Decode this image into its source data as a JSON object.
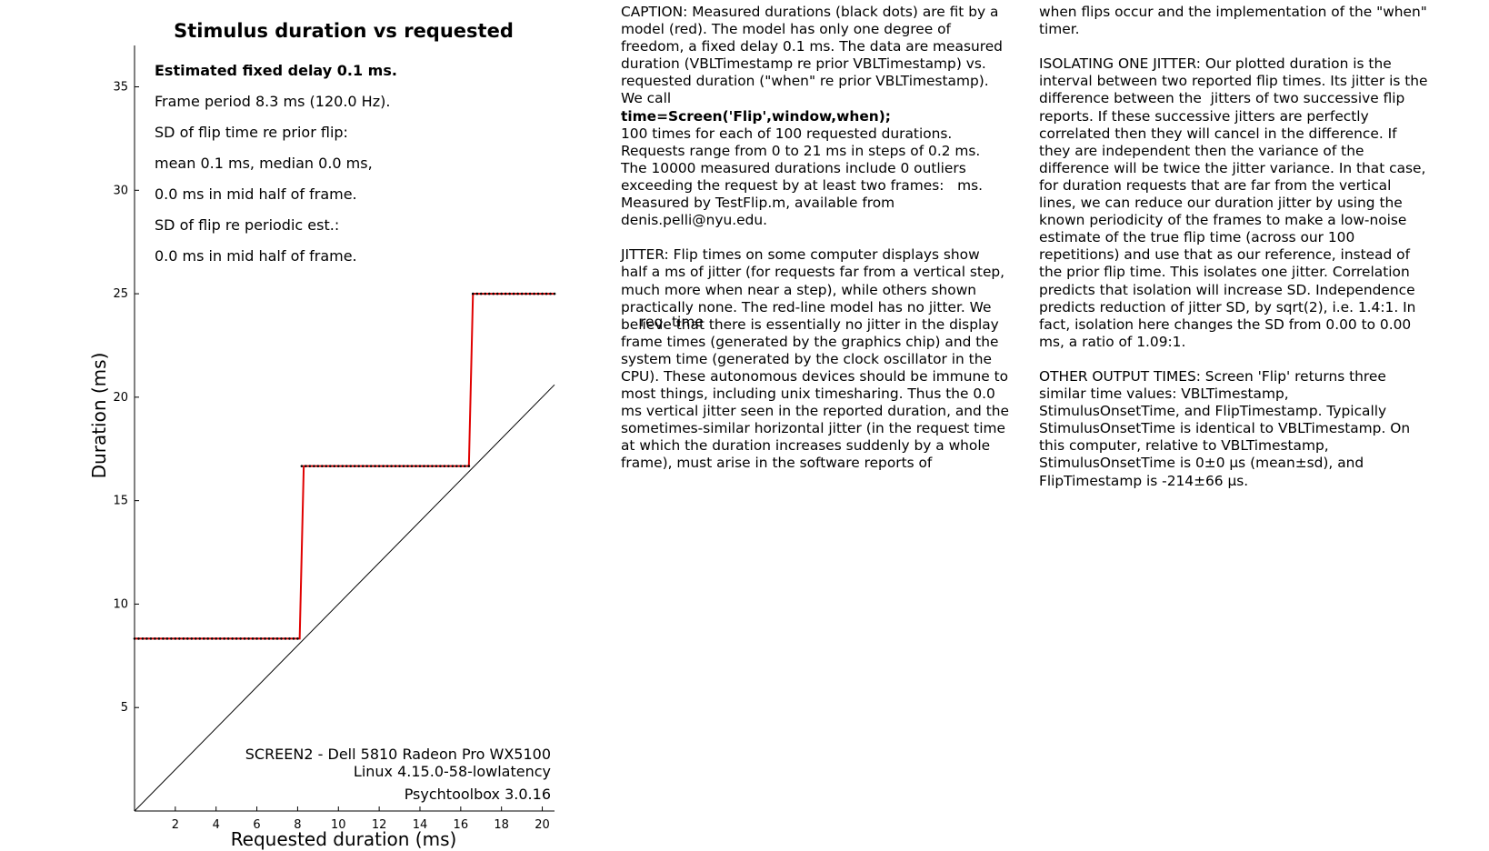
{
  "chart_data": {
    "type": "line",
    "title": "Stimulus duration vs requested",
    "xlabel": "Requested duration (ms)",
    "ylabel": "Duration (ms)",
    "xlim": [
      0,
      20.6
    ],
    "ylim": [
      0,
      37
    ],
    "x_ticks": [
      2,
      4,
      6,
      8,
      10,
      12,
      14,
      16,
      18,
      20
    ],
    "y_ticks": [
      5,
      10,
      15,
      20,
      25,
      30,
      35
    ],
    "series": [
      {
        "color": "#e00000",
        "style": "line",
        "x": [
          0,
          8.1,
          8.3,
          16.4,
          16.6,
          20.6
        ],
        "y": [
          8.33,
          8.33,
          16.67,
          16.67,
          25.0,
          25.0
        ]
      },
      {
        "color": "#000000",
        "style": "points",
        "x_range": [
          0,
          20.6
        ],
        "step": 0.2,
        "steps_at": [
          8.2,
          16.5
        ],
        "levels": [
          8.33,
          16.67,
          25.0
        ]
      },
      {
        "color": "#000000",
        "style": "identity-line",
        "x": [
          0,
          20.6
        ],
        "y": [
          0,
          20.6
        ]
      }
    ],
    "annotations": [
      {
        "text": "Estimated fixed delay 0.1 ms.",
        "bold": true
      },
      {
        "text": "Frame period 8.3 ms (120.0 Hz)."
      },
      {
        "text": "SD of flip time re prior flip:"
      },
      {
        "text": "mean 0.1 ms, median 0.0 ms,"
      },
      {
        "text": "0.0 ms in mid half of frame."
      },
      {
        "text": "SD of flip re periodic est.:"
      },
      {
        "text": "0.0 ms in mid half of frame."
      }
    ],
    "footer": [
      "SCREEN2 - Dell 5810 Radeon Pro WX5100",
      "Linux 4.15.0-58-lowlatency",
      "Psychtoolbox 3.0.16"
    ],
    "grid": false
  },
  "stray_label": "req. time",
  "caption": {
    "col1": [
      "CAPTION: Measured durations (black dots) are fit by a",
      "model (red). The model has only one degree of",
      "freedom, a fixed delay 0.1 ms. The data are measured",
      "duration (VBLTimestamp re prior VBLTimestamp) vs.",
      "requested duration (\"when\" re prior VBLTimestamp).",
      "We call",
      "**time=Screen('Flip',window,when);",
      "100 times for each of 100 requested durations.",
      "Requests range from 0 to 21 ms in steps of 0.2 ms.",
      "The 10000 measured durations include 0 outliers",
      "exceeding the request by at least two frames:   ms.",
      "Measured by TestFlip.m, available from",
      "denis.pelli@nyu.edu.",
      "",
      "JITTER: Flip times on some computer displays show",
      "half a ms of jitter (for requests far from a vertical step,",
      "much more when near a step), while others shown",
      "practically none. The red-line model has no jitter. We",
      "believe that there is essentially no jitter in the display",
      "frame times (generated by the graphics chip) and the",
      "system time (generated by the clock oscillator in the",
      "CPU). These autonomous devices should be immune to",
      "most things, including unix timesharing. Thus the 0.0",
      "ms vertical jitter seen in the reported duration, and the",
      "sometimes-similar horizontal jitter (in the request time",
      "at which the duration increases suddenly by a whole",
      "frame), must arise in the software reports of"
    ],
    "col2": [
      "when flips occur and the implementation of the \"when\"",
      "timer.",
      "",
      "ISOLATING ONE JITTER: Our plotted duration is the",
      "interval between two reported flip times. Its jitter is the",
      "difference between the  jitters of two successive flip",
      "reports. If these successive jitters are perfectly",
      "correlated then they will cancel in the difference. If",
      "they are independent then the variance of the",
      "difference will be twice the jitter variance. In that case,",
      "for duration requests that are far from the vertical",
      "lines, we can reduce our duration jitter by using the",
      "known periodicity of the frames to make a low-noise",
      "estimate of the true flip time (across our 100",
      "repetitions) and use that as our reference, instead of",
      "the prior flip time. This isolates one jitter. Correlation",
      "predicts that isolation will increase SD. Independence",
      "predicts reduction of jitter SD, by sqrt(2), i.e. 1.4:1. In",
      "fact, isolation here changes the SD from 0.00 to 0.00",
      "ms, a ratio of 1.09:1.",
      "",
      "OTHER OUTPUT TIMES: Screen 'Flip' returns three",
      "similar time values: VBLTimestamp,",
      "StimulusOnsetTime, and FlipTimestamp. Typically",
      "StimulusOnsetTime is identical to VBLTimestamp. On",
      "this computer, relative to VBLTimestamp,",
      "StimulusOnsetTime is 0±0 µs (mean±sd), and",
      "FlipTimestamp is -214±66 µs."
    ]
  }
}
